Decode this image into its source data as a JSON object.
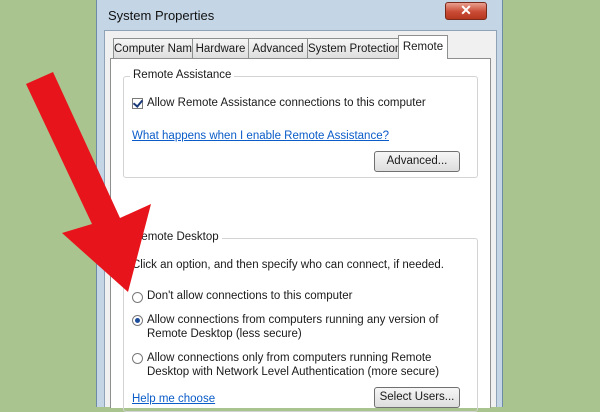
{
  "window": {
    "title": "System Properties",
    "close_label": "✕"
  },
  "tabs": [
    {
      "label": "Computer Name",
      "active": false
    },
    {
      "label": "Hardware",
      "active": false
    },
    {
      "label": "Advanced",
      "active": false
    },
    {
      "label": "System Protection",
      "active": false
    },
    {
      "label": "Remote",
      "active": true
    }
  ],
  "remote_assistance": {
    "legend": "Remote Assistance",
    "checkbox_label": "Allow Remote Assistance connections to this computer",
    "checked": true,
    "help_link": "What happens when I enable Remote Assistance?",
    "advanced_button": "Advanced..."
  },
  "remote_desktop": {
    "legend": "Remote Desktop",
    "instruction": "Click an option, and then specify who can connect, if needed.",
    "options": [
      {
        "line1": "Don't allow connections to this computer",
        "line2": "",
        "selected": false
      },
      {
        "line1": "Allow connections from computers running any version of",
        "line2": "Remote Desktop (less secure)",
        "selected": true
      },
      {
        "line1": "Allow connections only from computers running Remote",
        "line2": "Desktop with Network Level Authentication (more secure)",
        "selected": false
      }
    ],
    "help_link": "Help me choose",
    "select_users_button": "Select Users..."
  },
  "colors": {
    "background": "#a9c48f",
    "arrow": "#e8141b",
    "link": "#0b5cc9"
  }
}
